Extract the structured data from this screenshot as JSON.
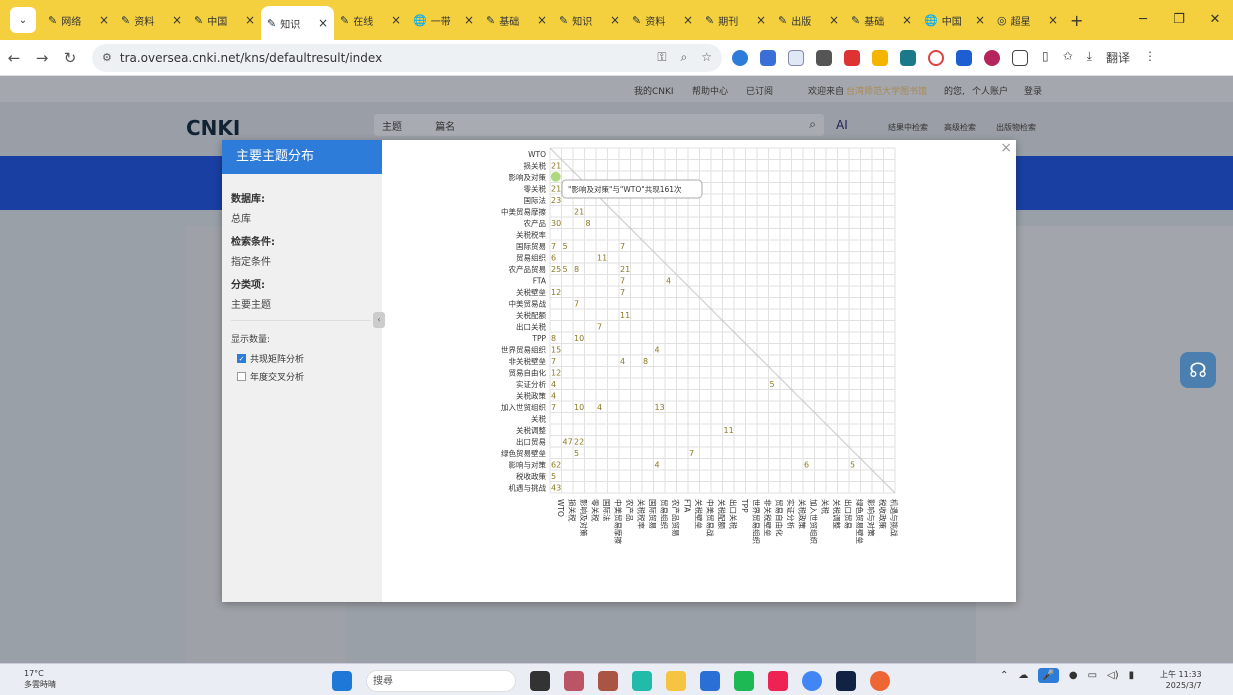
{
  "browser": {
    "tabs": [
      {
        "label": "网络",
        "icon": "cnki-icon"
      },
      {
        "label": "资料",
        "icon": "cnki-icon"
      },
      {
        "label": "中国",
        "icon": "cnki-icon"
      },
      {
        "label": "知识",
        "icon": "cnki-icon",
        "active": true
      },
      {
        "label": "在线",
        "icon": "cnki-icon"
      },
      {
        "label": "一带",
        "icon": "globe-icon"
      },
      {
        "label": "基础",
        "icon": "cnki-icon"
      },
      {
        "label": "知识",
        "icon": "cnki-icon"
      },
      {
        "label": "资料",
        "icon": "cnki-icon"
      },
      {
        "label": "期刊",
        "icon": "cnki-icon"
      },
      {
        "label": "出版",
        "icon": "cnki-icon"
      },
      {
        "label": "基础",
        "icon": "cnki-icon"
      },
      {
        "label": "中国",
        "icon": "globe-icon"
      },
      {
        "label": "超星",
        "icon": "duo-icon"
      }
    ],
    "url": "tra.oversea.cnki.net/kns/defaultresult/index",
    "toolbar_label": "翻译"
  },
  "site": {
    "top_links": [
      "我的CNKI",
      "帮助中心",
      "已订阅",
      "欢迎来自",
      "台湾师范大学图书馆",
      "的您,",
      "个人账户",
      "登录"
    ],
    "search_select": "主题",
    "search_placeholder": "篇名",
    "right_links": [
      "结果中检索",
      "高级检索",
      "出版物检索"
    ],
    "ai_label": "AI"
  },
  "modal": {
    "title": "主要主题分布",
    "db_label": "数据库:",
    "db_value": "总库",
    "cond_label": "检索条件:",
    "cond_value": "指定条件",
    "cat_label": "分类项:",
    "cat_value": "主要主题",
    "display_label": "显示数量:",
    "opt1": "共现矩阵分析",
    "opt2": "年度交叉分析",
    "tooltip": "\"影响及对策\"与\"WTO\"共现161次"
  },
  "chart_data": {
    "type": "heatmap",
    "title": "",
    "labels": [
      "WTO",
      "损关税",
      "影响及对策",
      "零关税",
      "国际法",
      "中美贸易摩擦",
      "农产品",
      "关税税率",
      "国际贸易",
      "贸易组织",
      "农产品贸易",
      "FTA",
      "关税壁垒",
      "中美贸易战",
      "关税配额",
      "出口关税",
      "TPP",
      "世界贸易组织",
      "非关税壁垒",
      "贸易自由化",
      "实证分析",
      "关税政策",
      "加入世贸组织",
      "关税",
      "关税调整",
      "出口贸易",
      "绿色贸易壁垒",
      "影响与对策",
      "税收政策",
      "机遇与挑战"
    ],
    "cells": [
      {
        "r": 1,
        "c": 0,
        "v": 21
      },
      {
        "r": 3,
        "c": 0,
        "v": 21
      },
      {
        "r": 4,
        "c": 0,
        "v": 23
      },
      {
        "r": 5,
        "c": 2,
        "v": 21
      },
      {
        "r": 6,
        "c": 0,
        "v": 30
      },
      {
        "r": 6,
        "c": 3,
        "v": 8
      },
      {
        "r": 8,
        "c": 0,
        "v": 7
      },
      {
        "r": 8,
        "c": 1,
        "v": 5
      },
      {
        "r": 8,
        "c": 6,
        "v": 7
      },
      {
        "r": 9,
        "c": 0,
        "v": 6
      },
      {
        "r": 9,
        "c": 4,
        "v": 11
      },
      {
        "r": 10,
        "c": 0,
        "v": 25
      },
      {
        "r": 10,
        "c": 1,
        "v": 5
      },
      {
        "r": 10,
        "c": 2,
        "v": 8
      },
      {
        "r": 10,
        "c": 6,
        "v": 21
      },
      {
        "r": 11,
        "c": 6,
        "v": 7
      },
      {
        "r": 11,
        "c": 10,
        "v": 4
      },
      {
        "r": 12,
        "c": 0,
        "v": 12
      },
      {
        "r": 12,
        "c": 6,
        "v": 7
      },
      {
        "r": 13,
        "c": 2,
        "v": 7
      },
      {
        "r": 14,
        "c": 6,
        "v": 11
      },
      {
        "r": 15,
        "c": 4,
        "v": 7
      },
      {
        "r": 16,
        "c": 0,
        "v": 8
      },
      {
        "r": 16,
        "c": 2,
        "v": 10
      },
      {
        "r": 17,
        "c": 0,
        "v": 15
      },
      {
        "r": 17,
        "c": 9,
        "v": 4
      },
      {
        "r": 18,
        "c": 0,
        "v": 7
      },
      {
        "r": 18,
        "c": 6,
        "v": 4
      },
      {
        "r": 18,
        "c": 8,
        "v": 8
      },
      {
        "r": 19,
        "c": 0,
        "v": 12
      },
      {
        "r": 20,
        "c": 0,
        "v": 4
      },
      {
        "r": 20,
        "c": 19,
        "v": 5
      },
      {
        "r": 21,
        "c": 0,
        "v": 4
      },
      {
        "r": 22,
        "c": 0,
        "v": 7
      },
      {
        "r": 22,
        "c": 2,
        "v": 10
      },
      {
        "r": 22,
        "c": 4,
        "v": 4
      },
      {
        "r": 22,
        "c": 9,
        "v": 13
      },
      {
        "r": 24,
        "c": 15,
        "v": 11
      },
      {
        "r": 25,
        "c": 1,
        "v": 47
      },
      {
        "r": 25,
        "c": 2,
        "v": 22
      },
      {
        "r": 26,
        "c": 2,
        "v": 5
      },
      {
        "r": 26,
        "c": 12,
        "v": 7
      },
      {
        "r": 27,
        "c": 0,
        "v": 62
      },
      {
        "r": 27,
        "c": 9,
        "v": 4
      },
      {
        "r": 27,
        "c": 22,
        "v": 6
      },
      {
        "r": 27,
        "c": 26,
        "v": 5
      },
      {
        "r": 28,
        "c": 0,
        "v": 5
      },
      {
        "r": 29,
        "c": 0,
        "v": 43
      }
    ],
    "highlight": {
      "r": 2,
      "c": 0,
      "v": 161
    }
  },
  "system": {
    "temp": "17°C",
    "weather": "多雲時晴",
    "search": "搜尋",
    "time": "上午 11:33",
    "date": "2025/3/7"
  }
}
